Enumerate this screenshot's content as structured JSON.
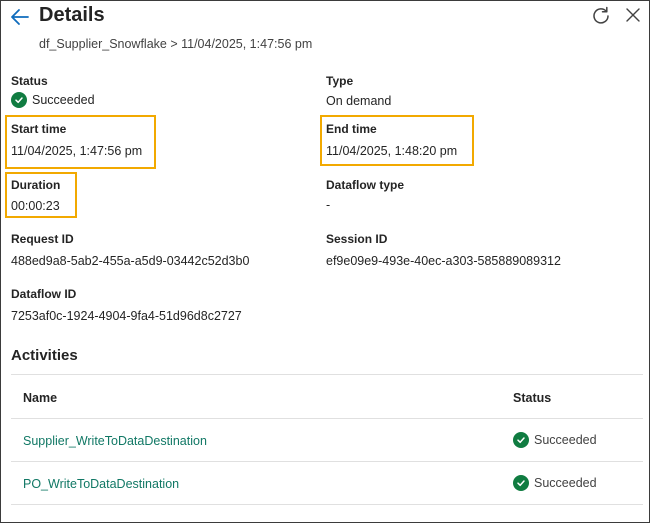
{
  "header": {
    "title": "Details",
    "breadcrumb": "df_Supplier_Snowflake > 11/04/2025, 1:47:56 pm"
  },
  "fields": {
    "status": {
      "label": "Status",
      "value": "Succeeded"
    },
    "type": {
      "label": "Type",
      "value": "On demand"
    },
    "start_time": {
      "label": "Start time",
      "value": "11/04/2025, 1:47:56 pm"
    },
    "end_time": {
      "label": "End time",
      "value": "11/04/2025, 1:48:20 pm"
    },
    "duration": {
      "label": "Duration",
      "value": "00:00:23"
    },
    "dataflow_type": {
      "label": "Dataflow type",
      "value": "-"
    },
    "request_id": {
      "label": "Request ID",
      "value": "488ed9a8-5ab2-455a-a5d9-03442c52d3b0"
    },
    "session_id": {
      "label": "Session ID",
      "value": "ef9e09e9-493e-40ec-a303-585889089312"
    },
    "dataflow_id": {
      "label": "Dataflow ID",
      "value": "7253af0c-1924-4904-9fa4-51d96d8c2727"
    }
  },
  "activities": {
    "title": "Activities",
    "columns": {
      "name": "Name",
      "status": "Status"
    },
    "rows": [
      {
        "name": "Supplier_WriteToDataDestination",
        "status": "Succeeded"
      },
      {
        "name": "PO_WriteToDataDestination",
        "status": "Succeeded"
      }
    ]
  },
  "icons": {
    "back": "arrow-left-icon",
    "refresh": "refresh-icon",
    "close": "close-icon",
    "success": "check-circle-icon"
  },
  "colors": {
    "accent": "#0f6cbd",
    "success": "#107c41",
    "link": "#117865",
    "highlight": "#f2a900"
  }
}
